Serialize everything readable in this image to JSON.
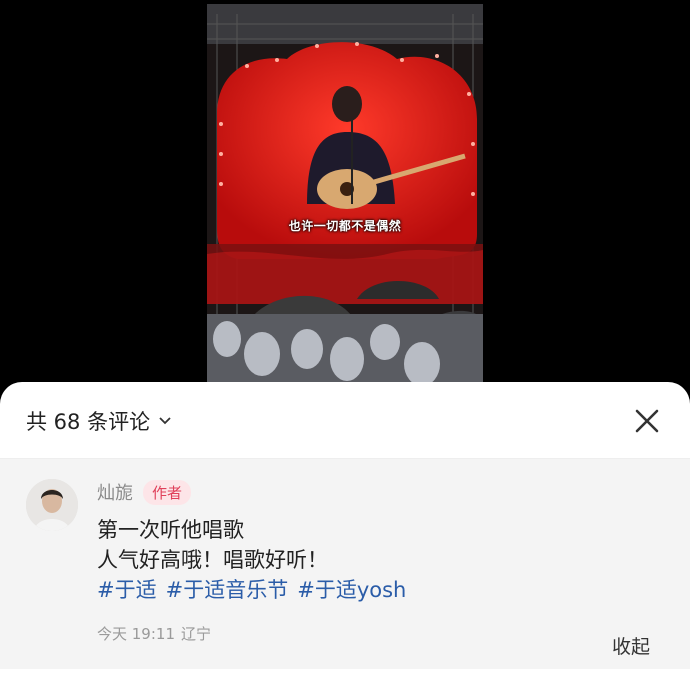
{
  "media": {
    "caption": "也许一切都不是偶然",
    "colors": {
      "heart": "#e01818",
      "background": "#2a1414",
      "stage": "#7a1010"
    }
  },
  "sheet": {
    "count_title": "共 68 条评论",
    "collapse_label": "收起"
  },
  "comment": {
    "author": "灿旎",
    "badge": "作者",
    "lines": [
      "第一次听他唱歌",
      "人气好高哦！唱歌好听！"
    ],
    "tags": [
      "#于适",
      "#于适音乐节",
      "#于适yosh"
    ],
    "time": "今天 19:11",
    "location": "辽宁"
  },
  "icons": {
    "dropdown": "chevron-down-icon",
    "close": "close-icon"
  }
}
